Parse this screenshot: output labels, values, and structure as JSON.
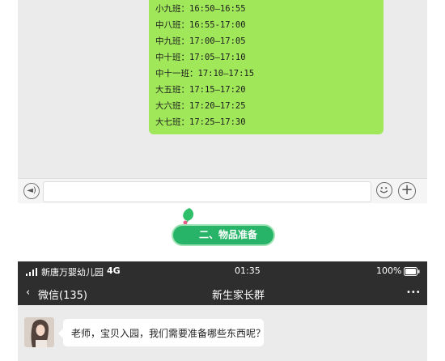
{
  "top_chat": {
    "schedule_lines": [
      "小九班：16:50—16:55",
      "中八班：16:55-17:00",
      "中九班：17:00—17:05",
      "中十班：17:05—17:10",
      "中十一班：17:10—17:15",
      "大五班：17:15—17:20",
      "大六班：17:20—17:25",
      "大七班：17:25—17:30"
    ]
  },
  "section": {
    "title": "二、物品准备"
  },
  "phone": {
    "status": {
      "carrier": "新唐万婴幼儿园",
      "network": "4G",
      "time": "01:35",
      "battery": "100%"
    },
    "nav": {
      "back_label": "微信(135)",
      "title": "新生家长群",
      "more": "•••"
    },
    "message": {
      "text": "老师，宝贝入园，我们需要准备哪些东西呢？"
    }
  },
  "colors": {
    "bubble_green": "#a0e75a",
    "pill_green": "#27b468",
    "dark_bar": "#2e2e2e"
  }
}
